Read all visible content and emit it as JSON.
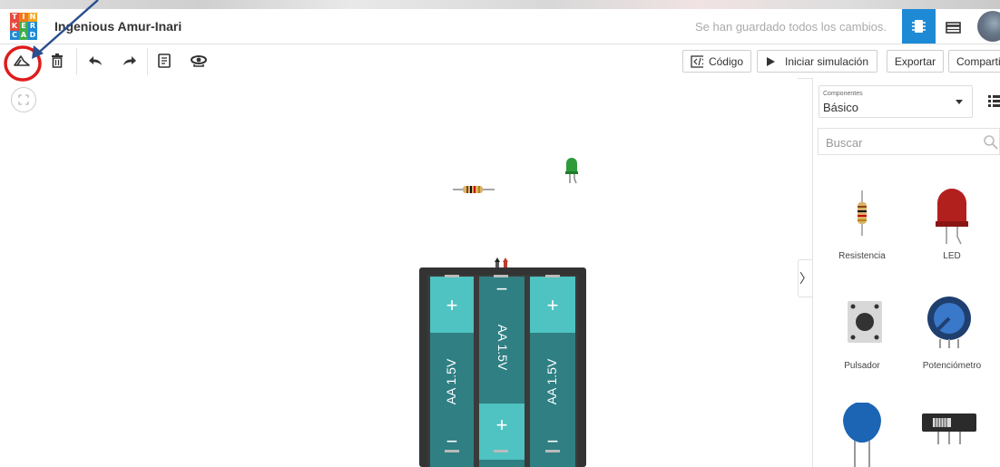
{
  "app": {
    "logo_letters": [
      "T",
      "I",
      "N",
      "K",
      "E",
      "R",
      "C",
      "A",
      "D"
    ],
    "project_title": "Ingenious Amur-Inari",
    "save_status": "Se han guardado todos los cambios."
  },
  "toolbar": {
    "code_label": "Código",
    "start_sim_label": "Iniciar simulación",
    "export_label": "Exportar",
    "share_label": "Compartir"
  },
  "panel": {
    "dropdown_small": "Componentes",
    "dropdown_value": "Básico",
    "search_placeholder": "Buscar",
    "components": [
      {
        "label": "Resistencia",
        "icon": "resistor-icon"
      },
      {
        "label": "LED",
        "icon": "led-icon"
      },
      {
        "label": "Pulsador",
        "icon": "pushbutton-icon"
      },
      {
        "label": "Potenciómetro",
        "icon": "potentiometer-icon"
      },
      {
        "label": "",
        "icon": "capacitor-icon"
      },
      {
        "label": "",
        "icon": "slide-switch-icon"
      }
    ]
  },
  "canvas": {
    "battery_label": "AA 1.5V",
    "plus": "+",
    "minus": "−"
  },
  "colors": {
    "accent_blue": "#1e8ad6",
    "battery_teal": "#2f7f83",
    "battery_cap": "#4fc2c2",
    "holder": "#333333",
    "annotation_red": "#e01b1b",
    "arrow_blue": "#2b4f8f"
  }
}
